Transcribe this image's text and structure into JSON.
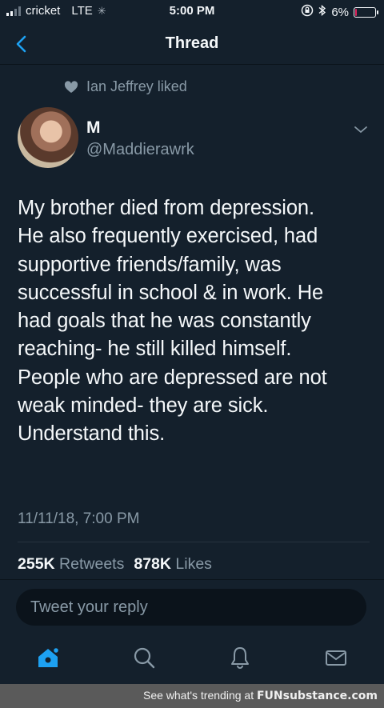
{
  "status_bar": {
    "carrier": "cricket",
    "network": "LTE",
    "time": "5:00 PM",
    "battery": "6%",
    "battery_level": 0.06
  },
  "nav": {
    "title": "Thread"
  },
  "social_context": {
    "text": "Ian Jeffrey liked"
  },
  "tweet": {
    "author_name": "M",
    "author_handle": "@Maddierawrk",
    "lines": [
      "My brother died from depression.",
      "He also frequently exercised, had",
      "supportive friends/family, was",
      "successful in school & in work. He",
      "had goals that he was constantly",
      "reaching- he still killed himself.",
      "People who are depressed are not",
      "weak minded- they are sick.",
      "Understand this."
    ],
    "timestamp": "11/11/18, 7:00 PM",
    "retweets_count": "255K",
    "retweets_label": "Retweets",
    "likes_count": "878K",
    "likes_label": "Likes"
  },
  "reply": {
    "placeholder": "Tweet your reply"
  },
  "colors": {
    "accent": "#1da1f2",
    "background": "#14202c",
    "muted": "#8899a6"
  },
  "banner": {
    "prefix": "See what's trending at",
    "brand": "FUNsubstance.com"
  }
}
